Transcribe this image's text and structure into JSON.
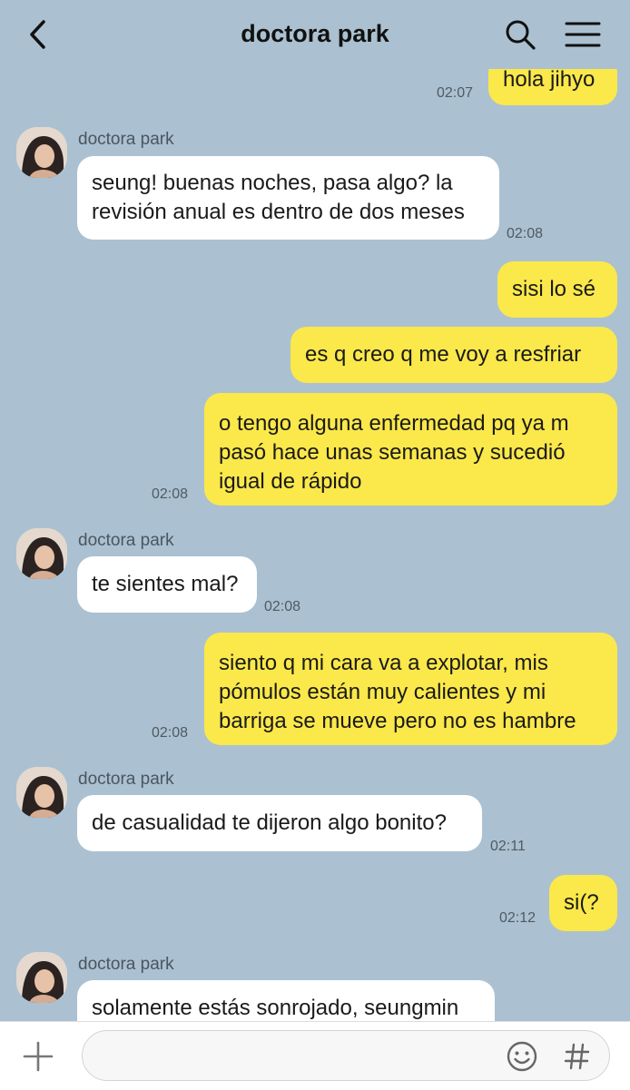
{
  "header": {
    "title": "doctora park"
  },
  "messages": [
    {
      "text": "hola jihyo",
      "time": "02:07"
    },
    {
      "sender": "doctora park",
      "lines": [
        "seung! buenas noches, pasa algo? la",
        "revisión anual es dentro de dos meses"
      ],
      "time": "02:08"
    },
    {
      "text": "sisi lo sé"
    },
    {
      "text": "es q creo q me voy a resfriar"
    },
    {
      "lines": [
        "o tengo alguna enfermedad pq ya m",
        "pasó hace unas semanas y sucedió",
        "igual de rápido"
      ],
      "time": "02:08"
    },
    {
      "sender": "doctora park",
      "text": "te sientes mal?",
      "time": "02:08"
    },
    {
      "lines": [
        "siento q mi cara va a explotar, mis",
        "pómulos están muy calientes y mi",
        "barriga se mueve pero no es hambre"
      ],
      "time": "02:08"
    },
    {
      "sender": "doctora park",
      "text": "de casualidad te dijeron algo bonito?",
      "time": "02:11"
    },
    {
      "text": "si(?",
      "time": "02:12"
    },
    {
      "sender": "doctora park",
      "text": "solamente estás sonrojado, seungmin"
    }
  ],
  "icons": {
    "back": "chevron-left-icon",
    "search": "search-icon",
    "menu": "hamburger-menu-icon",
    "plus": "plus-icon",
    "emoji": "emoji-icon",
    "hash": "hash-icon"
  },
  "colors": {
    "background": "#abc1d1",
    "my_bubble": "#fbe84a",
    "their_bubble": "#ffffff"
  }
}
